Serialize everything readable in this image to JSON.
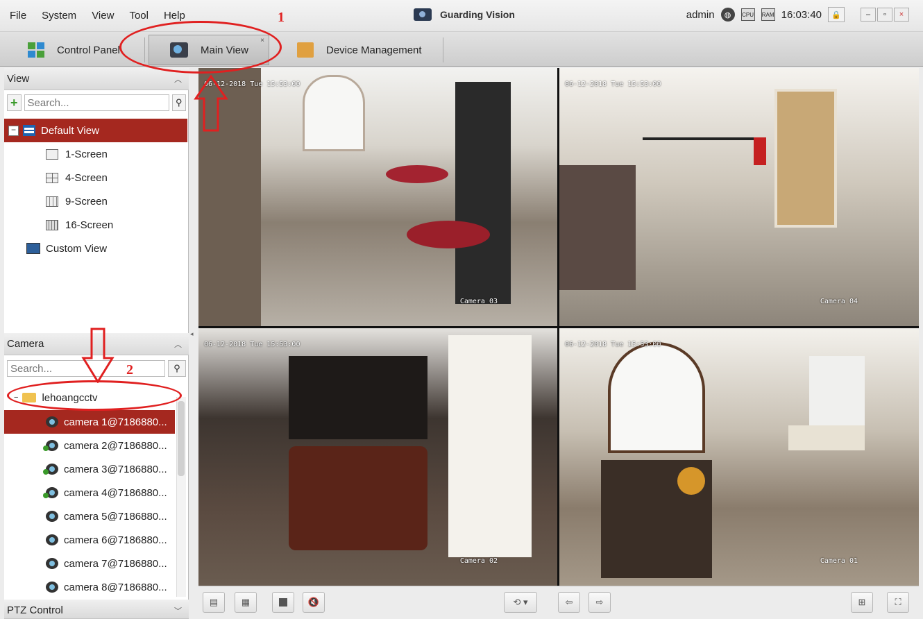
{
  "menu": {
    "items": [
      "File",
      "System",
      "View",
      "Tool",
      "Help"
    ]
  },
  "app": {
    "title": "Guarding Vision"
  },
  "status": {
    "user": "admin",
    "time": "16:03:40",
    "cpu_label": "CPU",
    "ram_label": "RAM"
  },
  "tabs": [
    {
      "label": "Control Panel"
    },
    {
      "label": "Main View",
      "close": "×"
    },
    {
      "label": "Device Management"
    }
  ],
  "view_panel": {
    "title": "View",
    "search_placeholder": "Search...",
    "default_view": "Default View",
    "screens": [
      "1-Screen",
      "4-Screen",
      "9-Screen",
      "16-Screen"
    ],
    "custom_view": "Custom View"
  },
  "camera_panel": {
    "title": "Camera",
    "search_placeholder": "Search...",
    "folder": "lehoangcctv",
    "cameras": [
      "camera 1@7186880...",
      "camera 2@7186880...",
      "camera 3@7186880...",
      "camera 4@7186880...",
      "camera 5@7186880...",
      "camera 6@7186880...",
      "camera 7@7186880...",
      "camera 8@7186880..."
    ]
  },
  "ptz_panel": {
    "title": "PTZ Control"
  },
  "feeds": [
    {
      "osd": "06-12-2018 Tue 15:53:00",
      "label": "Camera 03"
    },
    {
      "osd": "06-12-2018 Tue 15:53:00",
      "label": "Camera 04"
    },
    {
      "osd": "06-12-2018 Tue 15:53:00",
      "label": "Camera 02"
    },
    {
      "osd": "06-12-2018 Tue 15:53:00",
      "label": "Camera 01"
    }
  ],
  "annotations": {
    "one": "1",
    "two": "2"
  },
  "colors": {
    "selection": "#a5281f",
    "annotation": "#e02020"
  }
}
